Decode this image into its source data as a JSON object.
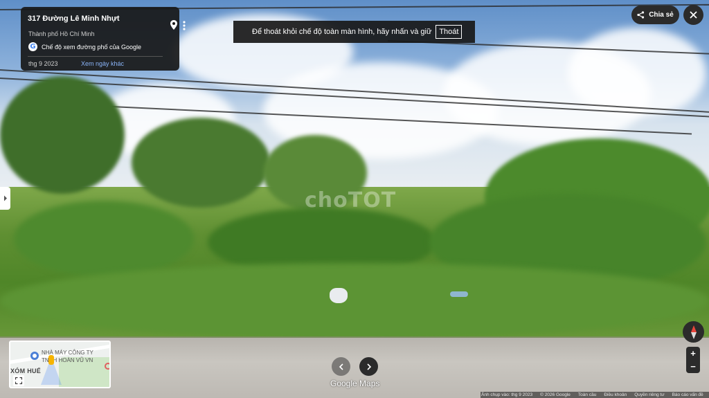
{
  "info_card": {
    "title": "317 Đường Lê Minh Nhựt",
    "subtitle": "Thành phố Hồ Chí Minh",
    "google_line": "Chế độ xem đường phố của Google",
    "date": "thg 9 2023",
    "other_dates": "Xem ngày khác"
  },
  "fullscreen_banner": {
    "text": "Để thoát khỏi chế độ toàn màn hình, hãy nhấn và giữ",
    "exit_label": "Thoát"
  },
  "share_button": {
    "label": "Chia sẻ"
  },
  "watermark": "choTOT",
  "minimap": {
    "poi_label_line1": "NHÀ MÁY CÔNG TY",
    "poi_label_line2": "TNHH HOÀN VŨ VN",
    "area_label": "XÓM HUẾ"
  },
  "brand": "Google Maps",
  "zoom": {
    "in": "+",
    "out": "−"
  },
  "footer": {
    "capture_date": "Ảnh chụp vào: thg 9 2023",
    "copyright": "© 2026 Google",
    "global": "Toàn cầu",
    "terms": "Điều khoản",
    "privacy": "Quyền riêng tư",
    "report": "Báo cáo vấn đề"
  }
}
